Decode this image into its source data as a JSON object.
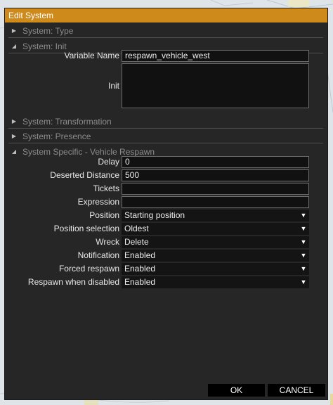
{
  "dialog": {
    "title": "Edit System",
    "sections": {
      "type": "System: Type",
      "init": "System: Init",
      "transformation": "System: Transformation",
      "presence": "System: Presence",
      "respawn": "System Specific - Vehicle Respawn"
    },
    "init_fields": {
      "variable_name_label": "Variable Name",
      "variable_name_value": "respawn_vehicle_west",
      "init_label": "Init",
      "init_value": ""
    },
    "respawn_fields": {
      "delay_label": "Delay",
      "delay_value": "0",
      "deserted_distance_label": "Deserted Distance",
      "deserted_distance_value": "500",
      "tickets_label": "Tickets",
      "tickets_value": "",
      "expression_label": "Expression",
      "expression_value": "",
      "position_label": "Position",
      "position_value": "Starting position",
      "position_selection_label": "Position selection",
      "position_selection_value": "Oldest",
      "wreck_label": "Wreck",
      "wreck_value": "Delete",
      "notification_label": "Notification",
      "notification_value": "Enabled",
      "forced_respawn_label": "Forced respawn",
      "forced_respawn_value": "Enabled",
      "respawn_when_disabled_label": "Respawn when disabled",
      "respawn_when_disabled_value": "Enabled"
    },
    "buttons": {
      "ok": "OK",
      "cancel": "CANCEL"
    },
    "icons": {
      "collapsed": "triangle-right-icon",
      "expanded": "triangle-down-icon",
      "dropdown": "triangle-down-icon"
    },
    "colors": {
      "title_bar": "#cf8a1c",
      "dialog_bg": "#262626",
      "field_bg": "#111111"
    }
  }
}
